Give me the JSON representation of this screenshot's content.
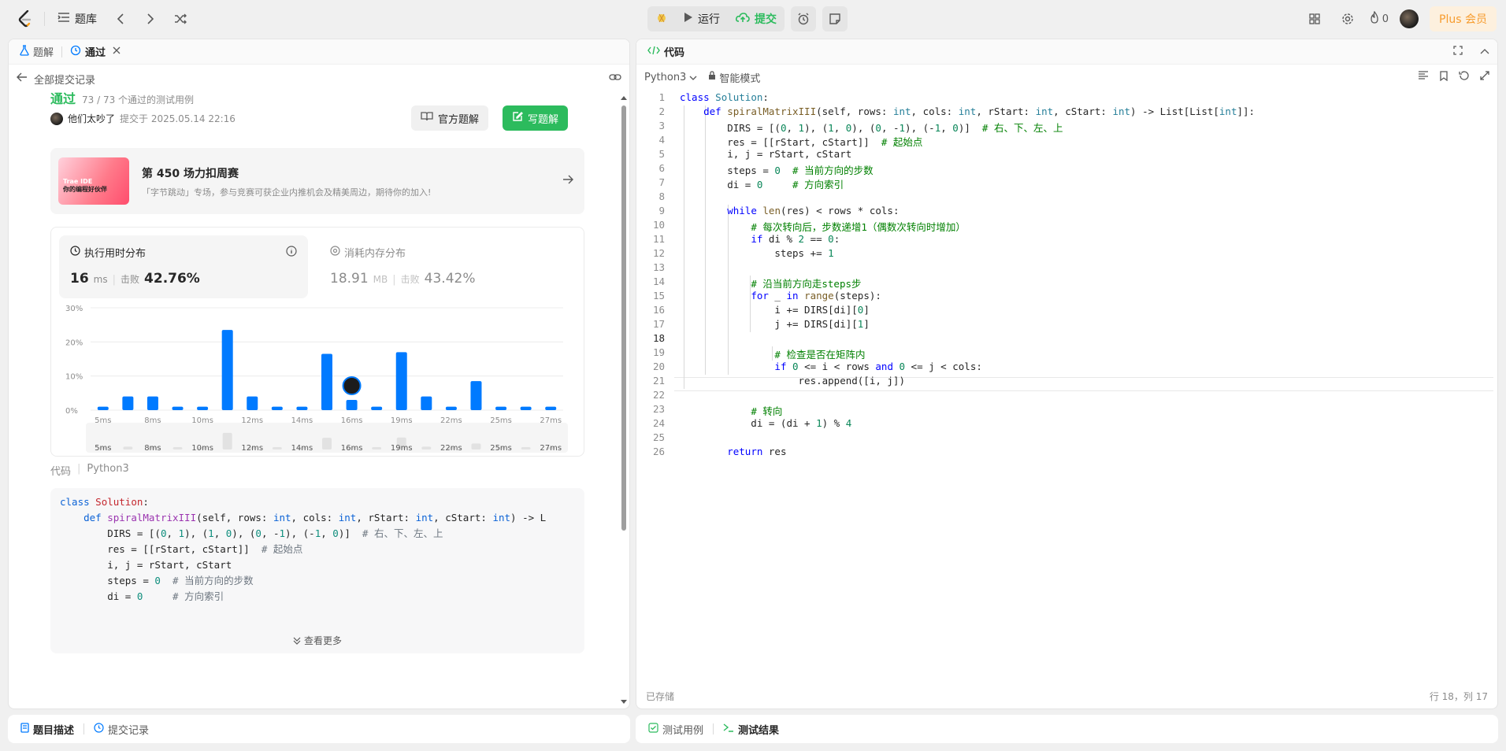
{
  "topbar": {
    "problem_bank": "题库",
    "run": "运行",
    "submit": "提交",
    "fire_count": "0",
    "plus": "Plus 会员"
  },
  "left_tabs": {
    "solutions": "题解",
    "accepted": "通过"
  },
  "back_label": "全部提交记录",
  "result": {
    "status": "通过",
    "tests": "73 / 73 个通过的测试用例",
    "user": "他们太吵了",
    "submitted_at": "提交于 2025.05.14 22:16",
    "official_btn": "官方题解",
    "write_btn": "写题解"
  },
  "banner": {
    "thumb_line1": "Trae IDE",
    "thumb_line2": "你的编程好伙伴",
    "title": "第 450 场力扣周赛",
    "desc": "「字节跳动」专场，参与竞赛可获企业内推机会及精美周边，期待你的加入!"
  },
  "stats": {
    "runtime": {
      "title": "执行用时分布",
      "value": "16",
      "unit": "ms",
      "beats_label": "击败",
      "beats": "42.76%"
    },
    "memory": {
      "title": "消耗内存分布",
      "value": "18.91",
      "unit": "MB",
      "beats_label": "击败",
      "beats": "43.42%"
    }
  },
  "chart_data": {
    "type": "bar",
    "ylabel": "",
    "xlabel": "",
    "yticks": [
      "30%",
      "20%",
      "10%",
      "0%"
    ],
    "ylim": [
      0,
      30
    ],
    "x_tick_labels": [
      "5ms",
      "8ms",
      "10ms",
      "12ms",
      "14ms",
      "16ms",
      "19ms",
      "22ms",
      "25ms",
      "27ms"
    ],
    "values": [
      1,
      4,
      4,
      1,
      1,
      23.5,
      4,
      1,
      1,
      16.5,
      3,
      1,
      17,
      4,
      1,
      8.5,
      1,
      1,
      1
    ],
    "highlight_index": 10,
    "minimap_labels": [
      "5ms",
      "8ms",
      "10ms",
      "12ms",
      "14ms",
      "16ms",
      "19ms",
      "22ms",
      "25ms",
      "27ms"
    ],
    "colors": {
      "bar": "#007aff",
      "minimap_bar": "#e5e5e5"
    }
  },
  "code_section": {
    "label": "代码",
    "lang": "Python3",
    "see_more": "查看更多"
  },
  "right": {
    "tab": "代码",
    "lang": "Python3",
    "mode": "智能模式",
    "saved": "已存储",
    "cursor": "行 18，列 17"
  },
  "bottom_left": {
    "desc": "题目描述",
    "submissions": "提交记录"
  },
  "bottom_right": {
    "testcase": "测试用例",
    "result": "测试结果"
  },
  "colors": {
    "accent_green": "#2cbb5d",
    "accent_blue": "#007aff",
    "plus_orange": "#f79c2e"
  }
}
